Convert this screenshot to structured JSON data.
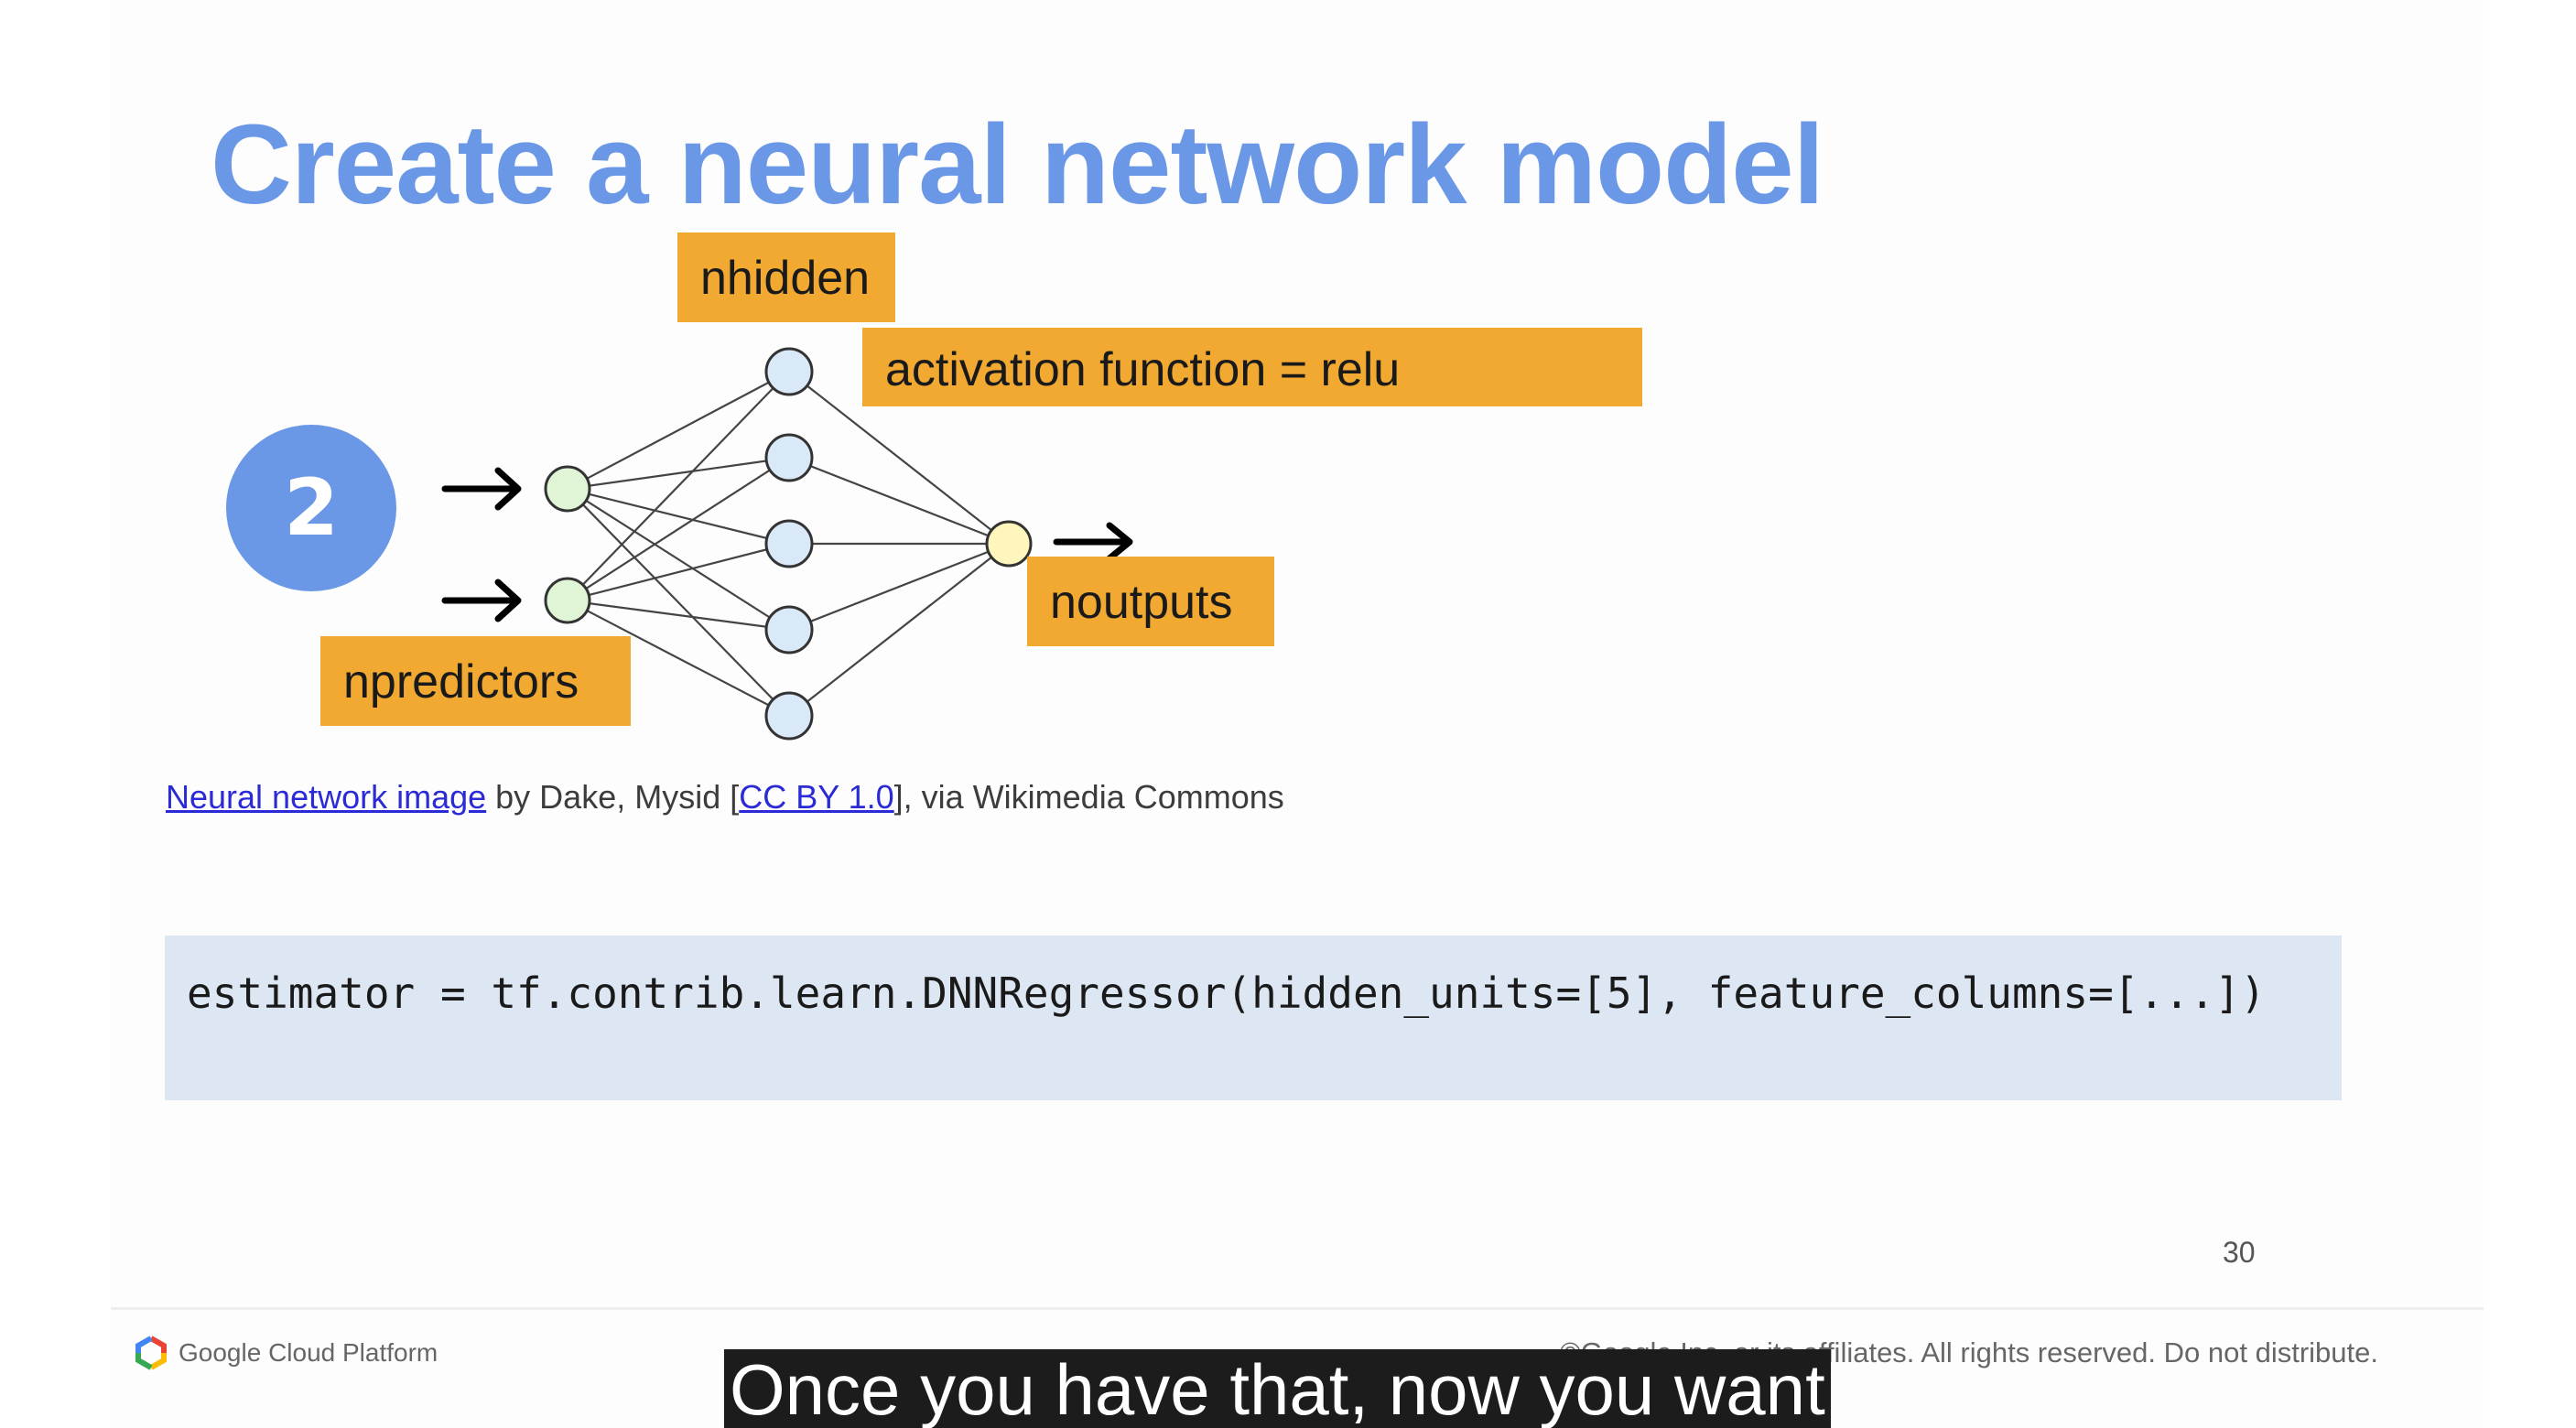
{
  "slide": {
    "title": "Create a neural network model",
    "labels": {
      "nhidden": "nhidden",
      "activation": "activation function = relu",
      "noutputs": "noutputs",
      "npredictors": "npredictors"
    },
    "badge_number": "2",
    "attribution": {
      "link1": "Neural network image",
      "text1": " by Dake, Mysid [",
      "link2": "CC BY 1.0",
      "text2": "], via Wikimedia Commons"
    },
    "code": "estimator = tf.contrib.learn.DNNRegressor(hidden_units=[5], feature_columns=[...])",
    "page_number": "30"
  },
  "footer": {
    "brand": "Google Cloud Platform",
    "copyright": "©Google Inc. or its affiliates. All rights reserved. Do not distribute."
  },
  "caption": "Once you have that, now you want",
  "colors": {
    "title": "#6a98e6",
    "label_fill": "#f1a932",
    "code_bg": "#dde7f3",
    "input_node": "#dff5d6",
    "hidden_node": "#dae9f7",
    "output_node": "#fff6bd"
  }
}
